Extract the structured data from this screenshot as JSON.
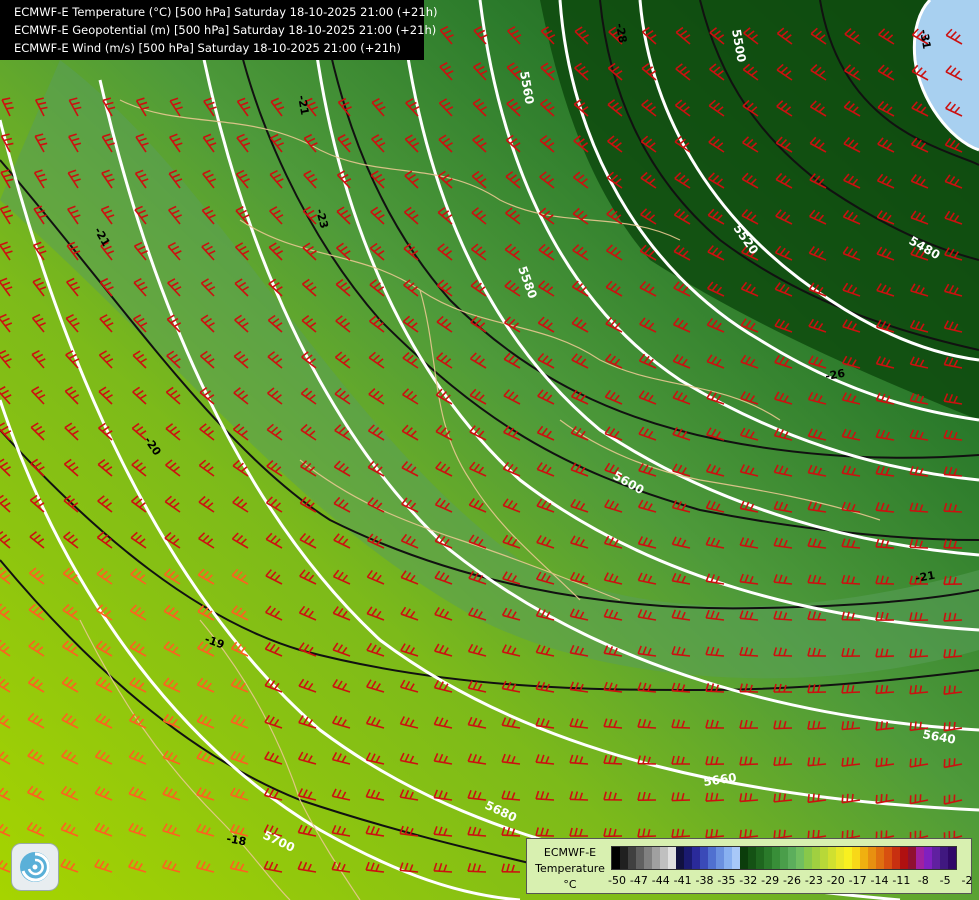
{
  "header": {
    "lines": [
      "ECMWF-E Temperature (°C) [500 hPa] Saturday 18-10-2025 21:00 (+21h)",
      "ECMWF-E Geopotential (m) [500 hPa] Saturday 18-10-2025 21:00 (+21h)",
      "ECMWF-E Wind (m/s) [500 hPa] Saturday 18-10-2025 21:00 (+21h)"
    ]
  },
  "legend": {
    "title_line1": "ECMWF-E",
    "title_line2": "Temperature",
    "unit": "°C",
    "ticks": [
      "-50",
      "-47",
      "-44",
      "-41",
      "-38",
      "-35",
      "-32",
      "-29",
      "-26",
      "-23",
      "-20",
      "-17",
      "-14",
      "-11",
      "-8",
      "-5",
      "-2"
    ],
    "colors": [
      "#000000",
      "#202020",
      "#404040",
      "#606060",
      "#808080",
      "#a0a0a0",
      "#c0c0c0",
      "#e0e0e0",
      "#101040",
      "#1a1a70",
      "#2a2a9a",
      "#3a4ab8",
      "#5070d0",
      "#6a90e0",
      "#88b0f0",
      "#a8c8f8",
      "#0b3d0b",
      "#145214",
      "#1e661e",
      "#2a7a2a",
      "#388e38",
      "#4a9e4a",
      "#5cae5c",
      "#70be60",
      "#88c84a",
      "#a0d040",
      "#b8d838",
      "#d0e030",
      "#e8e828",
      "#f8f020",
      "#f8d818",
      "#f0b010",
      "#e89010",
      "#e07010",
      "#d85010",
      "#c83010",
      "#b01010",
      "#901030",
      "#a020a0",
      "#8020c0",
      "#6020a0",
      "#401880",
      "#300868"
    ]
  },
  "geopotential_labels": [
    "5500",
    "5560",
    "5520",
    "5580",
    "5480",
    "5600",
    "5640",
    "5660",
    "5680",
    "5700"
  ],
  "temperature_labels": [
    "-28",
    "-31",
    "-21",
    "-23",
    "-26",
    "-20",
    "-19",
    "-18",
    "-21",
    "-21"
  ],
  "chart_data": {
    "type": "map",
    "fields": [
      "Temperature (°C)",
      "Geopotential (m)",
      "Wind (m/s)"
    ],
    "level": "500 hPa",
    "valid_time": "Saturday 18-10-2025 21:00 (+21h)",
    "geopotential_contours_m": [
      5480,
      5500,
      5520,
      5560,
      5580,
      5600,
      5640,
      5660,
      5680,
      5700
    ],
    "temperature_contours_c": [
      -31,
      -28,
      -26,
      -23,
      -21,
      -20,
      -19,
      -18
    ],
    "temperature_colorbar_ticks": [
      -50,
      -47,
      -44,
      -41,
      -38,
      -35,
      -32,
      -29,
      -26,
      -23,
      -20,
      -17,
      -14,
      -11,
      -8,
      -5,
      -2
    ]
  }
}
